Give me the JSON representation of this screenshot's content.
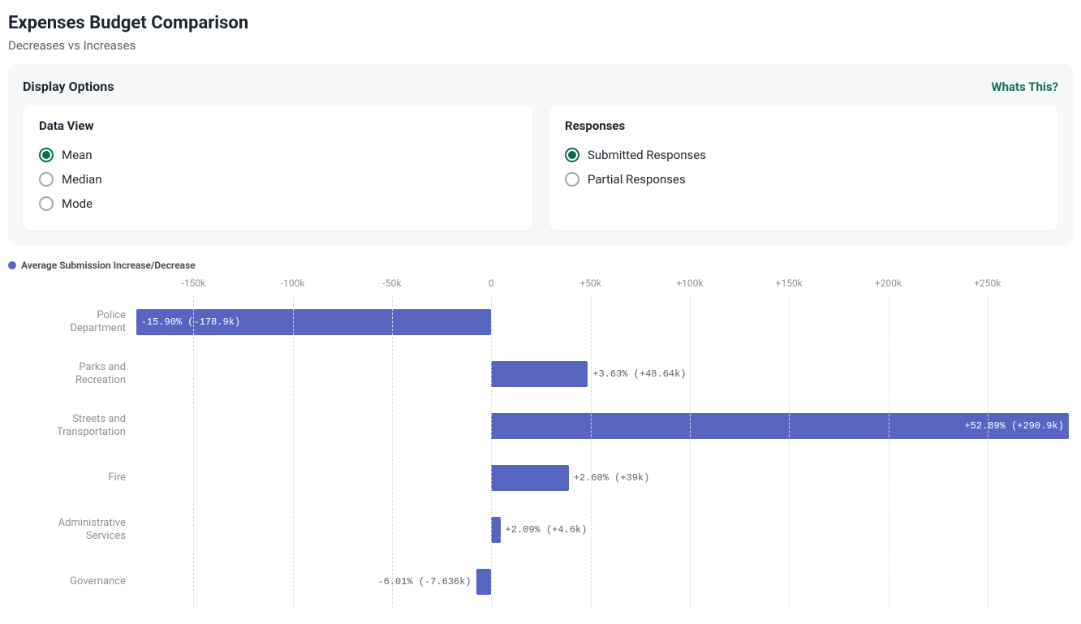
{
  "title": "Expenses Budget Comparison",
  "subtitle": "Decreases vs Increases",
  "options_panel": {
    "title": "Display Options",
    "whats_this": "Whats This?",
    "data_view": {
      "title": "Data View",
      "options": [
        "Mean",
        "Median",
        "Mode"
      ],
      "selected": "Mean"
    },
    "responses": {
      "title": "Responses",
      "options": [
        "Submitted Responses",
        "Partial Responses"
      ],
      "selected": "Submitted Responses"
    }
  },
  "legend": "Average Submission Increase/Decrease",
  "chart_data": {
    "type": "bar",
    "orientation": "horizontal",
    "xlabel": "",
    "ylabel": "",
    "x_ticks": [
      -150,
      -100,
      -50,
      0,
      50,
      100,
      150,
      200,
      250
    ],
    "x_tick_labels": [
      "-150k",
      "-100k",
      "-50k",
      "0",
      "+50k",
      "+100k",
      "+150k",
      "+200k",
      "+250k"
    ],
    "x_range_k": [
      -180,
      293
    ],
    "categories": [
      "Police Department",
      "Parks and Recreation",
      "Streets and Transportation",
      "Fire",
      "Administrative Services",
      "Governance"
    ],
    "values_k": [
      -178.9,
      48.64,
      290.9,
      39,
      4.6,
      -7.636
    ],
    "percent_change": [
      -15.9,
      3.63,
      52.89,
      2.6,
      2.09,
      -6.01
    ],
    "data_labels": [
      "-15.90% (-178.9k)",
      "+3.63% (+48.64k)",
      "+52.89% (+290.9k)",
      "+2.60% (+39k)",
      "+2.09% (+4.6k)",
      "-6.01% (-7.636k)"
    ],
    "bar_color": "#5765c1"
  }
}
